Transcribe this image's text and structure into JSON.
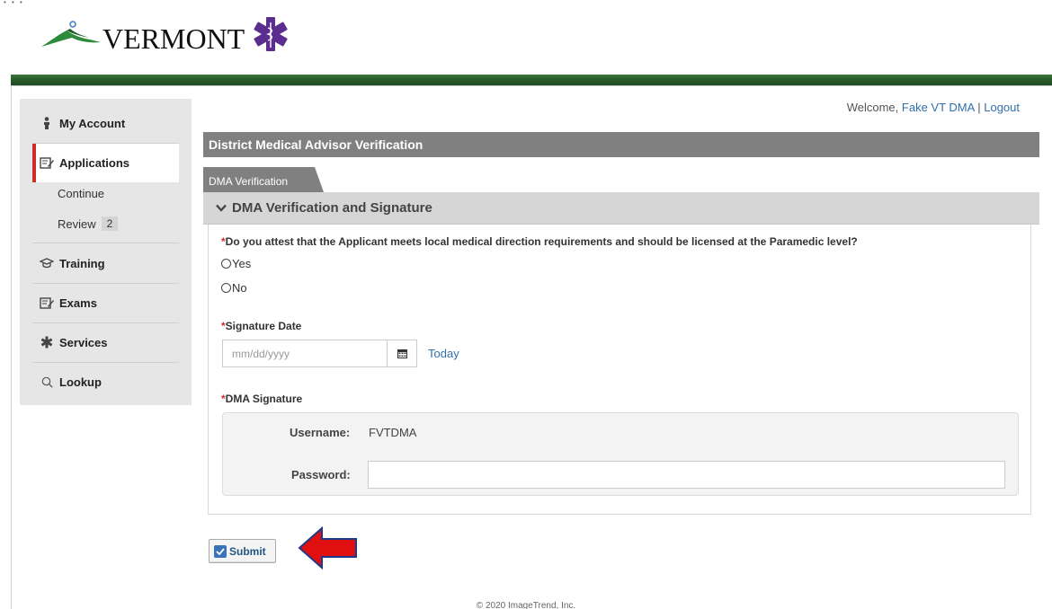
{
  "logo": {
    "text": "VERMONT"
  },
  "header": {
    "welcome_prefix": "Welcome,",
    "user_name": "Fake VT DMA",
    "separator": "|",
    "logout": "Logout"
  },
  "sidebar": {
    "items": [
      {
        "label": "My Account",
        "icon": "person-icon"
      },
      {
        "label": "Applications",
        "icon": "edit-icon"
      },
      {
        "label": "Training",
        "icon": "graduation-cap-icon"
      },
      {
        "label": "Exams",
        "icon": "edit-icon"
      },
      {
        "label": "Services",
        "icon": "star-of-life-icon"
      },
      {
        "label": "Lookup",
        "icon": "search-icon"
      }
    ],
    "sub_items": [
      {
        "label": "Continue"
      },
      {
        "label": "Review",
        "badge": "2"
      }
    ],
    "active": "Applications",
    "active_color": "#c9302c"
  },
  "page": {
    "title": "District Medical Advisor Verification",
    "tab": "DMA Verification",
    "section": "DMA Verification and Signature"
  },
  "form": {
    "question": {
      "required": "*",
      "label": "Do you attest that the Applicant meets local medical direction requirements and should be licensed at the Paramedic level?",
      "options": [
        "Yes",
        "No"
      ]
    },
    "signature_date": {
      "required": "*",
      "label": "Signature Date",
      "placeholder": "mm/dd/yyyy",
      "today_link": "Today"
    },
    "dma_signature": {
      "required": "*",
      "label": "DMA Signature",
      "username_label": "Username:",
      "username_value": "FVTDMA",
      "password_label": "Password:",
      "password_value": ""
    },
    "submit_label": "Submit"
  },
  "footer": {
    "text": "© 2020 ImageTrend, Inc."
  },
  "colors": {
    "header_bar": "#2a5e2a",
    "title_bar": "#808080",
    "link": "#2f6faa",
    "required": "#c9302c",
    "annotation_arrow": "#e01010"
  }
}
